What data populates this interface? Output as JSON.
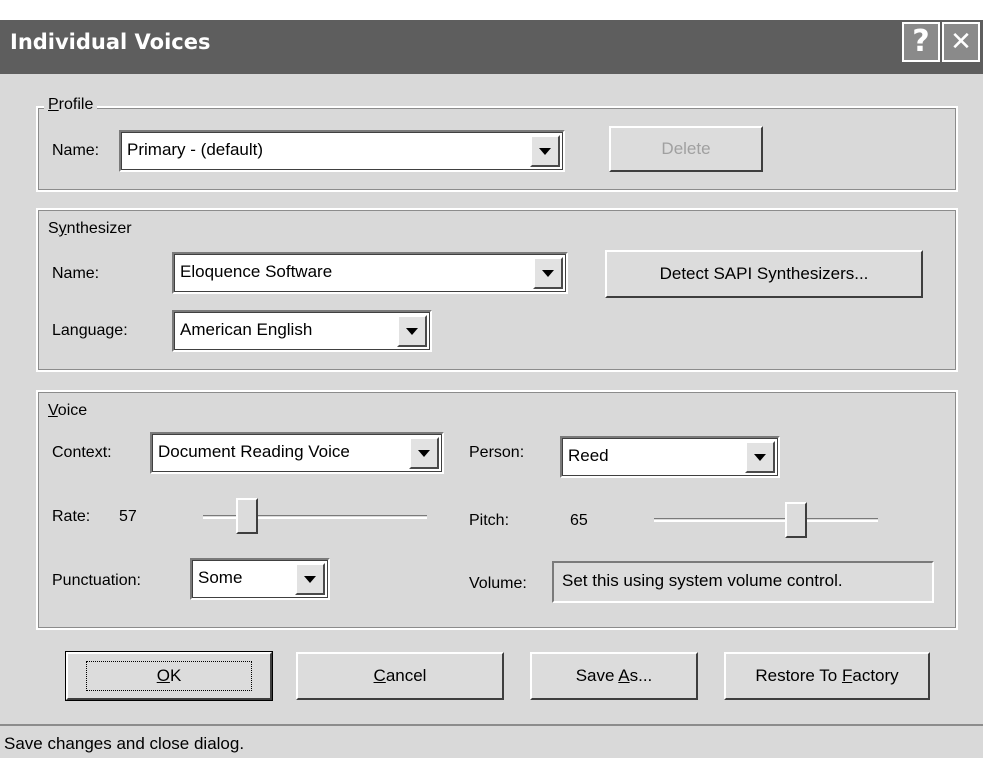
{
  "window": {
    "title": "Individual Voices",
    "help_glyph": "?",
    "close_glyph": "✕"
  },
  "profile": {
    "group_label": "Profile",
    "name_label": "Name:",
    "name_value": "Primary - (default)",
    "delete_button": "Delete"
  },
  "synthesizer": {
    "group_label": "Synthesizer",
    "name_label": "Name:",
    "name_value": "Eloquence Software",
    "detect_button": "Detect SAPI Synthesizers...",
    "language_label": "Language:",
    "language_value": "American English"
  },
  "voice": {
    "group_label": "Voice",
    "context_label": "Context:",
    "context_value": "Document Reading Voice",
    "person_label": "Person:",
    "person_value": "Reed",
    "rate_label": "Rate:",
    "rate_value": "57",
    "pitch_label": "Pitch:",
    "pitch_value": "65",
    "punctuation_label": "Punctuation:",
    "punctuation_value": "Some",
    "volume_label": "Volume:",
    "volume_value": "Set this using system volume control."
  },
  "buttons": {
    "ok": "OK",
    "cancel": "Cancel",
    "save_as": "Save As...",
    "restore": "Restore To Factory"
  },
  "status": {
    "text": "Save changes and close dialog."
  }
}
